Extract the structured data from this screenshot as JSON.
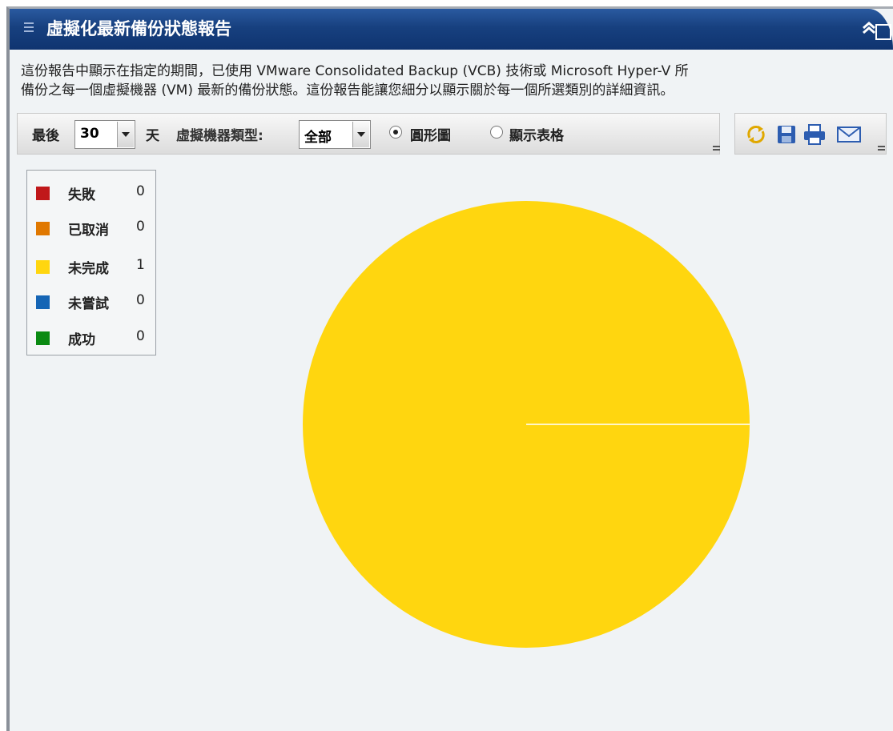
{
  "window": {
    "title": "虛擬化最新備份狀態報告",
    "grip_icon": "grip-lines-icon",
    "collapse_icon": "double-chevron-up-icon",
    "maximize_icon": "maximize-square-icon"
  },
  "description": {
    "line1": "這份報告中顯示在指定的期間，已使用 VMware Consolidated Backup (VCB) 技術或 Microsoft Hyper-V 所",
    "line2": "備份之每一個虛擬機器 (VM) 最新的備份狀態。這份報告能讓您細分以顯示關於每一個所選類別的詳細資訊。"
  },
  "toolbar": {
    "last_label": "最後",
    "days_value": "30",
    "days_unit": "天",
    "vm_type_label": "虛擬機器類型:",
    "vm_type_value": "全部",
    "radio_pie_label": "圓形圖",
    "radio_table_label": "顯示表格",
    "selected_view": "pie",
    "icons": [
      "refresh-icon",
      "save-icon",
      "print-icon",
      "email-icon"
    ]
  },
  "colors": {
    "failed": "#c0181a",
    "cancelled": "#e07800",
    "incomplete": "#ffd60f",
    "not_attempted": "#1565b5",
    "success": "#0a8a12",
    "title_bar": "#17407f",
    "background": "#f0f3f5"
  },
  "chart_data": {
    "type": "pie",
    "categories": [
      "失敗",
      "已取消",
      "未完成",
      "未嘗試",
      "成功"
    ],
    "values": [
      0,
      0,
      1,
      0,
      0
    ],
    "colors": [
      "#c0181a",
      "#e07800",
      "#ffd60f",
      "#1565b5",
      "#0a8a12"
    ],
    "legend_position": "top-left"
  }
}
